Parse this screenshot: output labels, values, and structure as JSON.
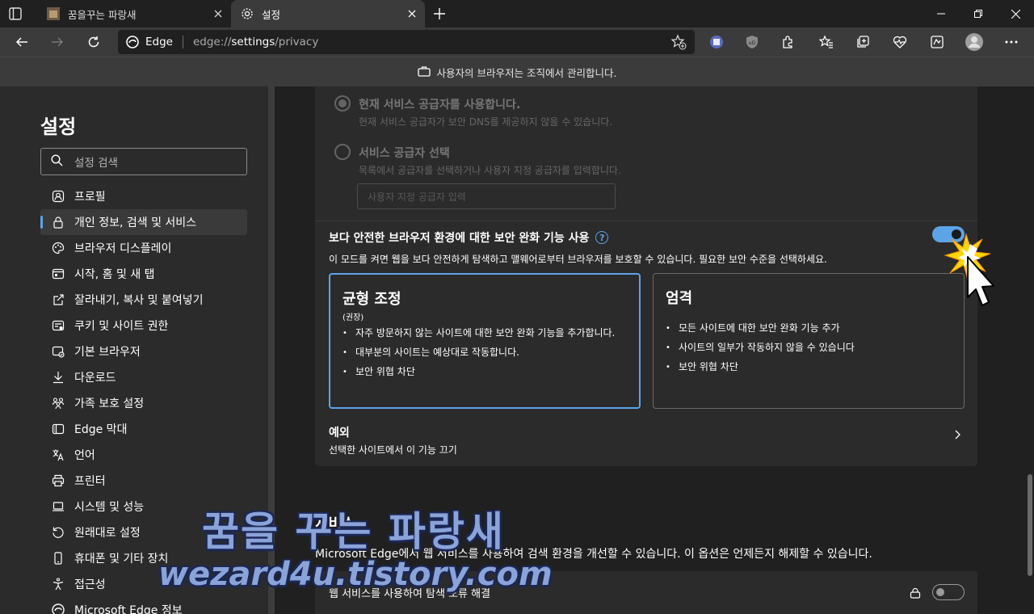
{
  "tabs": [
    {
      "title": "꿈을꾸는 파랑새"
    },
    {
      "title": "설정"
    }
  ],
  "toolbar": {
    "site_name": "Edge",
    "url_prefix": "edge://",
    "url_host": "settings",
    "url_path": "/privacy"
  },
  "infobar": {
    "text": "사용자의 브라우저는 조직에서 관리합니다."
  },
  "sidebar": {
    "title": "설정",
    "search_placeholder": "설정 검색",
    "items": [
      {
        "label": "프로필",
        "icon": "profile-icon"
      },
      {
        "label": "개인 정보, 검색 및 서비스",
        "icon": "lock-icon",
        "active": true
      },
      {
        "label": "브라우저 디스플레이",
        "icon": "palette-icon"
      },
      {
        "label": "시작, 홈 및 새 탭",
        "icon": "home-tab-icon"
      },
      {
        "label": "잘라내기, 복사 및 붙여넣기",
        "icon": "share-icon"
      },
      {
        "label": "쿠키 및 사이트 권한",
        "icon": "site-permissions-icon"
      },
      {
        "label": "기본 브라우저",
        "icon": "default-browser-icon"
      },
      {
        "label": "다운로드",
        "icon": "download-icon"
      },
      {
        "label": "가족 보호 설정",
        "icon": "family-icon"
      },
      {
        "label": "Edge 막대",
        "icon": "edge-bar-icon"
      },
      {
        "label": "언어",
        "icon": "language-icon"
      },
      {
        "label": "프린터",
        "icon": "printer-icon"
      },
      {
        "label": "시스템 및 성능",
        "icon": "laptop-icon"
      },
      {
        "label": "원래대로 설정",
        "icon": "reset-icon"
      },
      {
        "label": "휴대폰 및 기타 장치",
        "icon": "phone-icon"
      },
      {
        "label": "접근성",
        "icon": "accessibility-icon"
      },
      {
        "label": "Microsoft Edge 정보",
        "icon": "edge-logo-icon"
      }
    ]
  },
  "dns": {
    "option1_title": "현재 서비스 공급자를 사용합니다.",
    "option1_desc": "현재 서비스 공급자가 보안 DNS를 제공하지 않을 수 있습니다.",
    "option2_title": "서비스 공급자 선택",
    "option2_desc": "목록에서 공급자를 선택하거나 사용자 지정 공급자를 입력합니다.",
    "custom_placeholder": "사용자 지정 공급자 입력"
  },
  "security": {
    "title": "보다 안전한 브라우저 환경에 대한 보안 완화 기능 사용",
    "help": "?",
    "description": "이 모드를 켜면 웹을 보다 안전하게 탐색하고 맬웨어로부터 브라우저를 보호할 수 있습니다. 필요한 보안 수준을 선택하세요.",
    "toggle_on": true,
    "balanced": {
      "title": "균형 조정",
      "recommended": "(권장)",
      "bullets": [
        "자주 방문하지 않는 사이트에 대한 보안 완화 기능을 추가합니다.",
        "대부분의 사이트는 예상대로 작동합니다.",
        "보안 위협 차단"
      ]
    },
    "strict": {
      "title": "엄격",
      "bullets": [
        "모든 사이트에 대한 보안 완화 기능 추가",
        "사이트의 일부가 작동하지 않을 수 있습니다",
        "보안 위협 차단"
      ]
    },
    "exceptions_title": "예외",
    "exceptions_desc": "선택한 사이트에서 이 기능 끄기"
  },
  "services": {
    "title": "서비스",
    "description": "Microsoft Edge에서 웹 서비스를 사용하여 검색 환경을 개선할 수 있습니다. 이 옵션은 언제든지 해제할 수 있습니다.",
    "first_row": "웹 서비스를 사용하여 탐색 오류 해결",
    "first_row_on": false
  },
  "watermark": {
    "line1": "꿈을 꾸는 파랑새",
    "line2": "wezard4u.tistory.com"
  },
  "colors": {
    "accent": "#5da3e8",
    "bg": "#202020",
    "panel": "#2b2b2b"
  }
}
